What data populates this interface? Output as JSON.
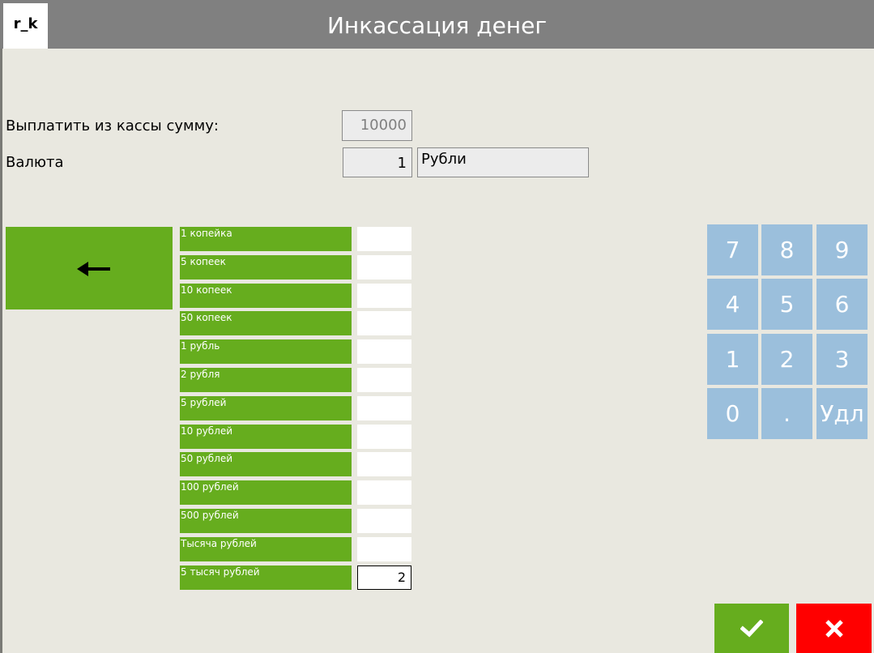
{
  "header": {
    "logo_text": "r_k",
    "title": "Инкассация денег"
  },
  "form": {
    "amount_label": "Выплатить из кассы сумму:",
    "amount_value": "10000",
    "currency_label": "Валюта",
    "currency_code": "1",
    "currency_name": "Рубли"
  },
  "denominations": [
    {
      "label": "1 копейка",
      "value": ""
    },
    {
      "label": "5 копеек",
      "value": ""
    },
    {
      "label": "10 копеек",
      "value": ""
    },
    {
      "label": "50 копеек",
      "value": ""
    },
    {
      "label": "1 рубль",
      "value": ""
    },
    {
      "label": "2 рубля",
      "value": ""
    },
    {
      "label": "5 рублей",
      "value": ""
    },
    {
      "label": "10 рублей",
      "value": ""
    },
    {
      "label": "50 рублей",
      "value": ""
    },
    {
      "label": "100 рублей",
      "value": ""
    },
    {
      "label": "500 рублей",
      "value": ""
    },
    {
      "label": "Тысяча рублей",
      "value": ""
    },
    {
      "label": "5 тысяч рублей",
      "value": "2"
    }
  ],
  "keypad": {
    "keys": [
      "7",
      "8",
      "9",
      "4",
      "5",
      "6",
      "1",
      "2",
      "3",
      "0",
      ".",
      "Удл"
    ]
  },
  "icons": {
    "back": "arrow-left-icon",
    "ok": "checkmark-icon",
    "cancel": "close-icon"
  },
  "colors": {
    "header_bg": "#808080",
    "accent_green": "#66ad1e",
    "keypad_blue": "#9bbfdc",
    "cancel_red": "#ff0000",
    "page_bg": "#e9e8e0"
  }
}
